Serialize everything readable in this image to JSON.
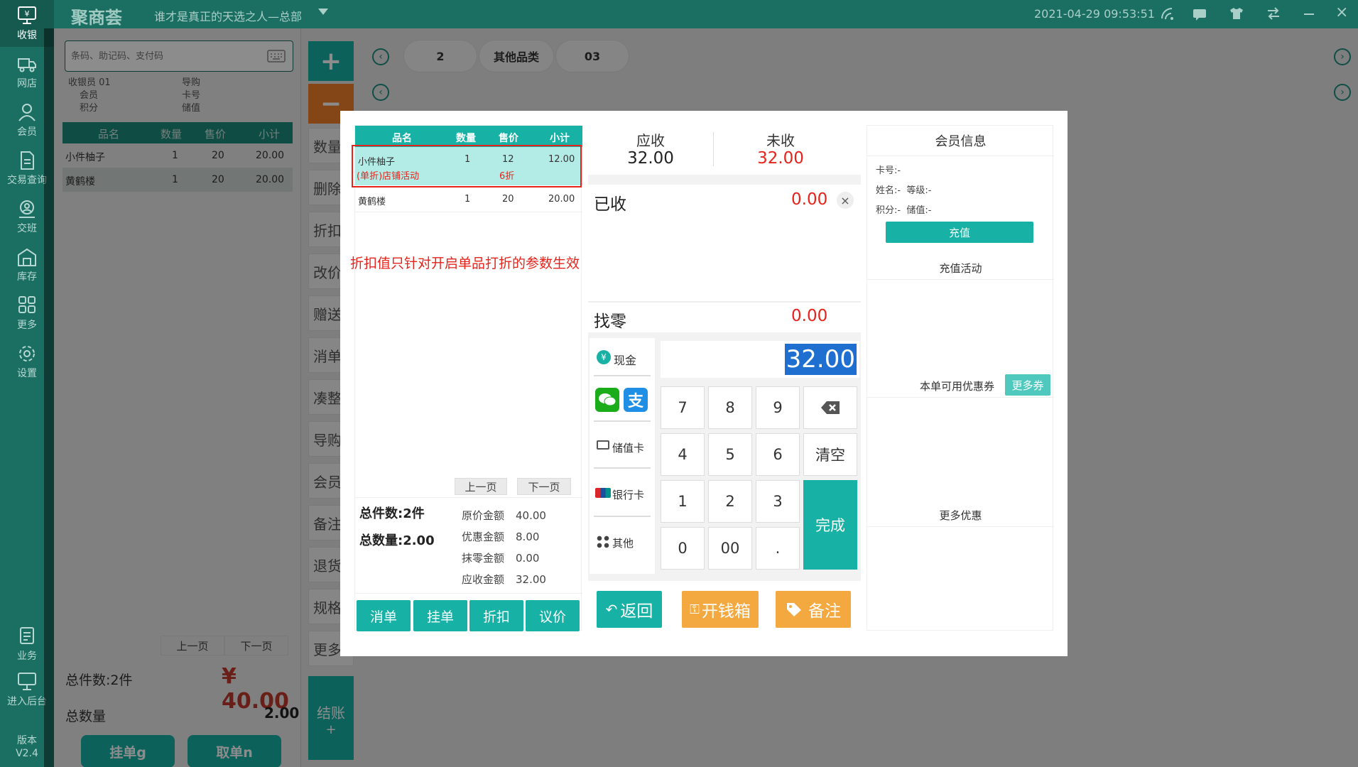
{
  "topbar": {
    "logo": "聚商荟",
    "store": "谁才是真正的天选之人—总部",
    "datetime": "2021-04-29 09:53:51"
  },
  "sidebar": {
    "items": [
      {
        "label": "收银"
      },
      {
        "label": "网店"
      },
      {
        "label": "会员"
      },
      {
        "label": "交易查询"
      },
      {
        "label": "交班"
      },
      {
        "label": "库存"
      },
      {
        "label": "更多"
      },
      {
        "label": "设置"
      },
      {
        "label": "业务"
      },
      {
        "label": "进入后台"
      }
    ],
    "version_label": "版本",
    "version": "V2.4"
  },
  "left": {
    "search_placeholder": "条码、助记码、支付码",
    "cashier_label": "收银员",
    "cashier_value": "01",
    "guide_label": "导购",
    "member_label": "会员",
    "card_label": "卡号",
    "points_label": "积分",
    "balance_label": "储值",
    "headers": [
      "品名",
      "数量",
      "售价",
      "小计"
    ],
    "rows": [
      {
        "name": "小件柚子",
        "qty": "1",
        "price": "20",
        "subtotal": "20.00"
      },
      {
        "name": "黄鹤楼",
        "qty": "1",
        "price": "20",
        "subtotal": "20.00"
      }
    ],
    "prev": "上一页",
    "next": "下一页",
    "total_items_label": "总件数:2件",
    "total_amount": "¥ 40.00",
    "total_qty_label": "总数量",
    "total_qty": "2.00",
    "hang_button": "挂单g",
    "take_button": "取单n"
  },
  "mid": {
    "plus": "+",
    "minus": "−",
    "buttons": [
      "数量",
      "删除",
      "折扣",
      "改价",
      "赠送",
      "消单",
      "凑整",
      "导购",
      "会员",
      "备注",
      "退货",
      "规格",
      "更多"
    ],
    "checkout": "结账",
    "checkout_plus": "+"
  },
  "categories": {
    "tabs": [
      "2",
      "其他品类",
      "03"
    ]
  },
  "dialog": {
    "order": {
      "headers": [
        "品名",
        "数量",
        "售价",
        "小计"
      ],
      "rows": [
        {
          "name": "小件柚子",
          "qty": "1",
          "price": "12",
          "subtotal": "12.00",
          "promo": "(单折)店铺活动",
          "discount": "6折"
        },
        {
          "name": "黄鹤楼",
          "qty": "1",
          "price": "20",
          "subtotal": "20.00"
        }
      ],
      "annotation": "折扣值只针对开启单品打折的参数生效",
      "prev": "上一页",
      "next": "下一页",
      "total_items": "总件数:2件",
      "total_qty": "总数量:2.00",
      "original_label": "原价金额",
      "original": "40.00",
      "discount_label": "优惠金额",
      "discount": "8.00",
      "rounding_label": "抹零金额",
      "rounding": "0.00",
      "due_label": "应收金额",
      "due": "32.00",
      "buttons": [
        "消单",
        "挂单",
        "折扣",
        "议价"
      ]
    },
    "pay": {
      "receivable_label": "应收",
      "receivable": "32.00",
      "unpaid_label": "未收",
      "unpaid": "32.00",
      "received_label": "已收",
      "received": "0.00",
      "change_label": "找零",
      "change": "0.00",
      "input_value": "32.00",
      "methods": {
        "cash": "现金",
        "stored": "储值卡",
        "bank": "银行卡",
        "other": "其他"
      },
      "keys": {
        "k7": "7",
        "k8": "8",
        "k9": "9",
        "k4": "4",
        "k5": "5",
        "k6": "6",
        "clear": "清空",
        "k1": "1",
        "k2": "2",
        "k3": "3",
        "done": "完成",
        "k0": "0",
        "k00": "00",
        "dot": "."
      },
      "back": "返回",
      "drawer": "开钱箱",
      "remark": "备注"
    },
    "member": {
      "title": "会员信息",
      "card": "卡号:-",
      "name": "姓名:-",
      "level": "等级:-",
      "points": "积分:-",
      "balance": "储值:-",
      "recharge": "充值",
      "recharge_activity": "充值活动",
      "coupon_label": "本单可用优惠券",
      "more_coupon": "更多券",
      "more_offers": "更多优惠"
    }
  },
  "colors": {
    "brand": "#1a6e62",
    "accent": "#17b1a6",
    "orange": "#f4a840",
    "red": "#e5231b"
  }
}
